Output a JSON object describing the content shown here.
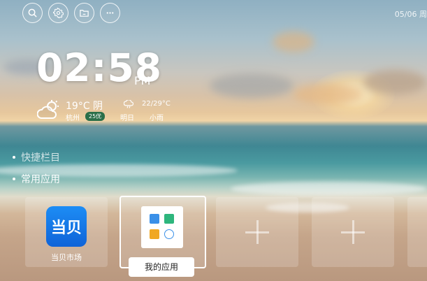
{
  "topbar": {
    "buttons": [
      {
        "name": "search",
        "icon": "search-icon"
      },
      {
        "name": "settings",
        "icon": "gear-icon"
      },
      {
        "name": "files",
        "icon": "folder-icon"
      },
      {
        "name": "more",
        "icon": "more-icon"
      }
    ],
    "date": "05/06 周"
  },
  "clock": {
    "time": "02:58",
    "ampm": "PM"
  },
  "weather": {
    "icon": "partly-cloudy-icon",
    "temp": "19°C 阴",
    "city": "杭州",
    "aqi": "25优",
    "forecast": {
      "icon": "rain-cloud-icon",
      "day": "明日",
      "temp": "22/29°C",
      "desc": "小雨"
    }
  },
  "sections": {
    "quick": "快捷栏目",
    "common": "常用应用"
  },
  "apps": {
    "dangbei": {
      "logo_text": "当贝",
      "label": "当贝市场"
    },
    "my_apps": {
      "label": "我的应用"
    }
  },
  "colors": {
    "accent_blue": "#1d8df5",
    "aqi_green": "#2b6f49"
  }
}
